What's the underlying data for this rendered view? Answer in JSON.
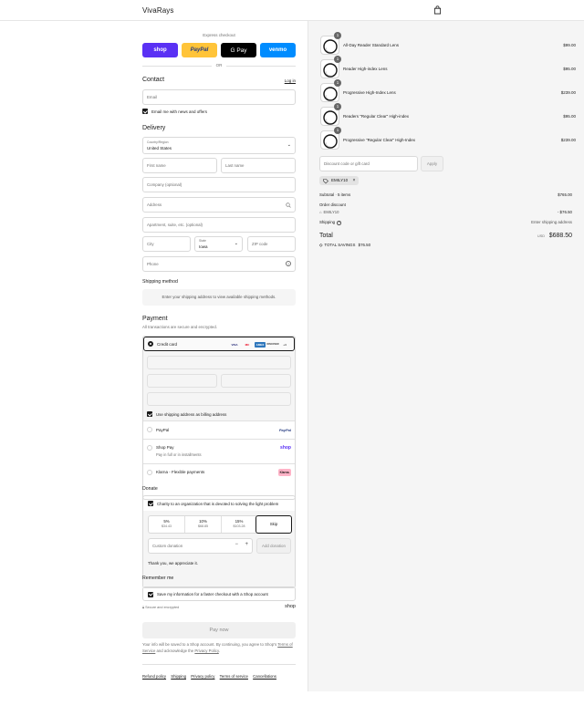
{
  "header": {
    "brand": "VivaRays",
    "cart_icon": "bag-icon"
  },
  "express": {
    "title": "Express checkout",
    "buttons": [
      {
        "label": "shop",
        "color": "#5a31f4"
      },
      {
        "label": "PayPal",
        "color": "#ffc439"
      },
      {
        "label": "G Pay",
        "color": "#000000"
      },
      {
        "label": "venmo",
        "color": "#008cff"
      }
    ],
    "or": "OR"
  },
  "contact": {
    "title": "Contact",
    "login": "Log in",
    "email_placeholder": "Email",
    "newsletter": "Email me with news and offers"
  },
  "delivery": {
    "title": "Delivery",
    "country_label": "Country/Region",
    "country_value": "United States",
    "first_name": "First name",
    "last_name": "Last name",
    "company": "Company (optional)",
    "address": "Address",
    "apartment": "Apartment, suite, etc. (optional)",
    "city": "City",
    "state_label": "State",
    "state_value": "Iowa",
    "zip": "ZIP code",
    "phone": "Phone"
  },
  "shipping_method": {
    "title": "Shipping method",
    "notice": "Enter your shipping address to view available shipping methods."
  },
  "payment": {
    "title": "Payment",
    "subtitle": "All transactions are secure and encrypted.",
    "credit_card": "Credit card",
    "card_brands": [
      "VISA",
      "MC",
      "AMEX",
      "DISCOVER"
    ],
    "more_cards": "+4",
    "billing_same": "Use shipping address as billing address",
    "paypal": "PayPal",
    "paypal_logo": "PayPal",
    "shop_pay": "Shop Pay",
    "shop_pay_sub": "Pay in full or in installments",
    "shop_logo": "shop",
    "klarna": "Klarna - Flexible payments",
    "klarna_logo": "Klarna."
  },
  "donate": {
    "title": "Donate",
    "charity": "Charity to an organization that is devoted to solving the light problem",
    "options": [
      {
        "pct": "5%",
        "amount": "$34.43"
      },
      {
        "pct": "10%",
        "amount": "$68.85"
      },
      {
        "pct": "15%",
        "amount": "$103.28"
      },
      {
        "pct": "Skip",
        "amount": ""
      }
    ],
    "custom_placeholder": "Custom donation",
    "minus": "−",
    "plus": "+",
    "add": "Add donation",
    "thanks": "Thank you, we appreciate it."
  },
  "remember": {
    "title": "Remember me",
    "save_info": "Save my information for a faster checkout with a Shop account",
    "secure": "Secure and encrypted",
    "shop_logo": "shop"
  },
  "pay_now": "Pay now",
  "disclaimer": {
    "pre": "Your info will be saved to a Shop account. By continuing, you agree to Shop's",
    "terms": "Terms of Service",
    "mid": "and acknowledge the",
    "privacy": "Privacy Policy",
    "post": "."
  },
  "footer_links": [
    "Refund policy",
    "Shipping",
    "Privacy policy",
    "Terms of service",
    "Cancellations"
  ],
  "summary": {
    "products": [
      {
        "qty": "1",
        "name": "All-Day Reader Standard Lens",
        "price": "$99.00"
      },
      {
        "qty": "1",
        "name": "Reader High-index Lens",
        "price": "$95.00"
      },
      {
        "qty": "1",
        "name": "Progressive High-Index Lens",
        "price": "$239.00"
      },
      {
        "qty": "1",
        "name": "Readers \"Regular Clear\" High-index",
        "price": "$95.00"
      },
      {
        "qty": "1",
        "name": "Progressive \"Regular Clear\" High-Index",
        "price": "$239.00"
      }
    ],
    "discount_placeholder": "Discount code or gift card",
    "apply": "Apply",
    "code_chip": "EMILY10",
    "subtotal_label": "Subtotal · 5 items",
    "subtotal": "$765.00",
    "order_discount": "Order discount",
    "discount_code": "EMILY10",
    "discount_amount": "- $76.50",
    "shipping_label": "Shipping",
    "shipping_value": "Enter shipping address",
    "total_label": "Total",
    "currency": "USD",
    "total": "$688.50",
    "savings_label": "TOTAL SAVINGS",
    "savings": "$76.50"
  }
}
